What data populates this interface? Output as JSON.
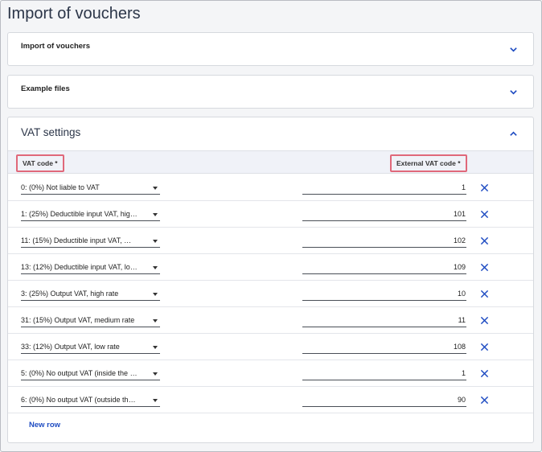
{
  "page": {
    "title": "Import of vouchers"
  },
  "sections": {
    "import": {
      "title": "Import of vouchers",
      "icon": "chevron-down-icon"
    },
    "examples": {
      "title": "Example files",
      "icon": "chevron-down-icon"
    },
    "vat": {
      "title": "VAT settings",
      "icon": "chevron-up-icon"
    }
  },
  "table": {
    "headers": {
      "vat_code": "VAT code *",
      "external_vat_code": "External VAT code *"
    },
    "rows": [
      {
        "vat_code": "0: (0%) Not liable to VAT",
        "external": "1"
      },
      {
        "vat_code": "1: (25%) Deductible input VAT, hig…",
        "external": "101"
      },
      {
        "vat_code": "11: (15%) Deductible input VAT, …",
        "external": "102"
      },
      {
        "vat_code": "13: (12%) Deductible input VAT, lo…",
        "external": "109"
      },
      {
        "vat_code": "3: (25%) Output VAT, high rate",
        "external": "10"
      },
      {
        "vat_code": "31: (15%) Output VAT, medium rate",
        "external": "11"
      },
      {
        "vat_code": "33: (12%) Output VAT, low rate",
        "external": "108"
      },
      {
        "vat_code": "5: (0%) No output VAT (inside the …",
        "external": "1"
      },
      {
        "vat_code": "6: (0%) No output VAT (outside th…",
        "external": "90"
      }
    ],
    "delete_icon": "close-icon",
    "new_row_label": "New row"
  },
  "colors": {
    "accent": "#1f4cc2",
    "highlight": "#e0687a",
    "title": "#2b3548"
  }
}
